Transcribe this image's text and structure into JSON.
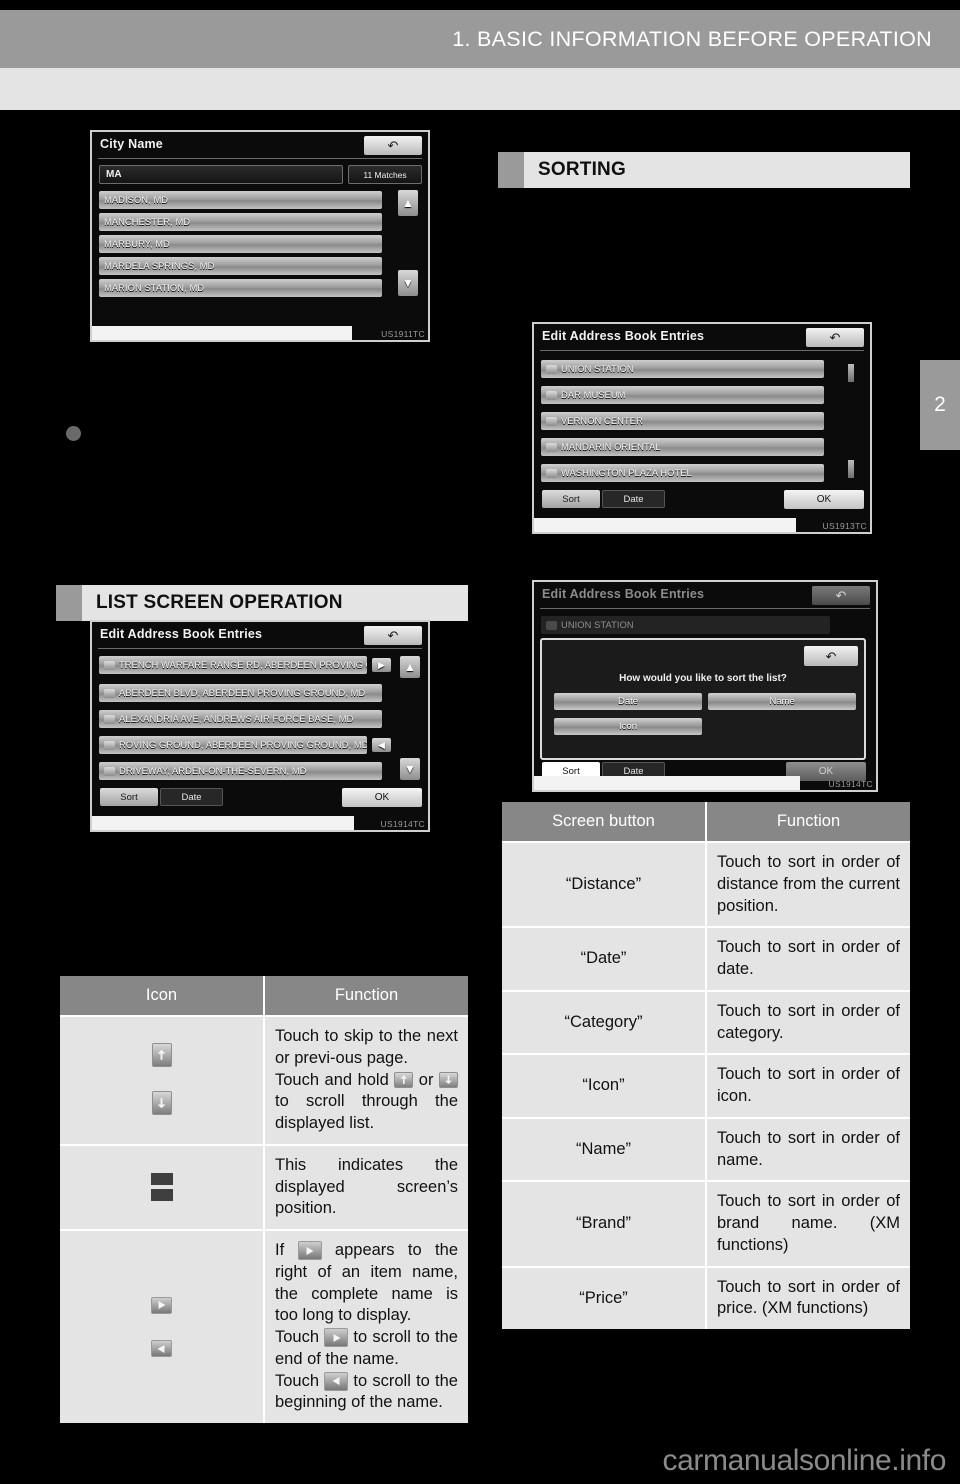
{
  "header": {
    "chapter_title": "1. BASIC INFORMATION BEFORE OPERATION",
    "chapter_tab_number": "2"
  },
  "sections": {
    "list_screen_operation": "LIST SCREEN OPERATION",
    "sorting": "SORTING"
  },
  "screens": {
    "city_name": {
      "title": "City Name",
      "code": "US1911TC",
      "back_icon": "back-arrow-icon",
      "input_value": "MA",
      "matches_label": "11 Matches",
      "items": [
        "MADISON, MD",
        "MANCHESTER, MD",
        "MARBURY, MD",
        "MARDELA SPRINGS, MD",
        "MARION STATION, MD"
      ],
      "scroll_up_icon": "scroll-up-icon",
      "scroll_down_icon": "scroll-down-icon"
    },
    "edit_address_book_long": {
      "title": "Edit Address Book Entries",
      "code": "US1914TC",
      "items": [
        "TRENCH WARFARE RANGE RD, ABERDEEN PROVING G",
        "ABERDEEN BLVD, ABERDEEN PROVING GROUND, MD",
        "ALEXANDRIA AVE, ANDREWS AIR FORCE BASE, MD",
        "ROVING GROUND, ABERDEEN PROVING GROUND, MD",
        "DRIVEWAY, ARDEN-ON-THE-SEVERN, MD"
      ],
      "sort_tab": "Sort",
      "date_tab": "Date",
      "ok_button": "OK"
    },
    "edit_address_book_sorted": {
      "title": "Edit Address Book Entries",
      "code": "US1913TC",
      "items": [
        "UNION STATION",
        "DAR MUSEUM",
        "VERNON CENTER",
        "MANDARIN ORIENTAL",
        "WASHINGTON PLAZA HOTEL"
      ],
      "sort_tab": "Sort",
      "date_tab": "Date",
      "ok_button": "OK"
    },
    "sort_dialog": {
      "title": "Edit Address Book Entries",
      "code": "US1914TC",
      "first_item": "UNION STATION",
      "question": "How would you like to sort the list?",
      "options": [
        "Date",
        "Name",
        "Icon"
      ],
      "sort_tab": "Sort",
      "date_tab": "Date",
      "ok_button": "OK"
    }
  },
  "icon_table": {
    "columns": [
      "Icon",
      "Function"
    ],
    "rows": [
      {
        "icons": [
          "page-up-icon",
          "page-down-icon"
        ],
        "function_parts": [
          "Touch to skip to the next or previ-ous page.",
          "Touch and hold ",
          " or ",
          " to scroll through the displayed list."
        ]
      },
      {
        "icons": [
          "screen-position-indicator-icon"
        ],
        "function_parts": [
          "This indicates the displayed screen’s position."
        ]
      },
      {
        "icons": [
          "scroll-right-icon",
          "scroll-left-icon"
        ],
        "function_parts": [
          "If ",
          " appears to the right of an item name, the complete name is too long to display.",
          "Touch ",
          " to scroll to the end of the name.",
          "Touch ",
          " to scroll to the beginning of the name."
        ]
      }
    ]
  },
  "sorting_table": {
    "columns": [
      "Screen button",
      "Function"
    ],
    "rows": [
      {
        "button": "“Distance”",
        "function": "Touch to sort in order of distance from the current position."
      },
      {
        "button": "“Date”",
        "function": "Touch to sort in order of date."
      },
      {
        "button": "“Category”",
        "function": "Touch to sort in order of category."
      },
      {
        "button": "“Icon”",
        "function": "Touch to sort in order of icon."
      },
      {
        "button": "“Name”",
        "function": "Touch to sort in order of name."
      },
      {
        "button": "“Brand”",
        "function": "Touch to sort in order of brand name. (XM functions)"
      },
      {
        "button": "“Price”",
        "function": "Touch to sort in order of price. (XM functions)"
      }
    ]
  },
  "footer": {
    "watermark": "carmanualsonline.info"
  },
  "colors": {
    "header_gray": "#9a9a9a",
    "subbar_gray": "#e4e4e4",
    "table_header_gray": "#878787",
    "table_body_gray": "#e4e4e4",
    "page_background": "#000000"
  }
}
